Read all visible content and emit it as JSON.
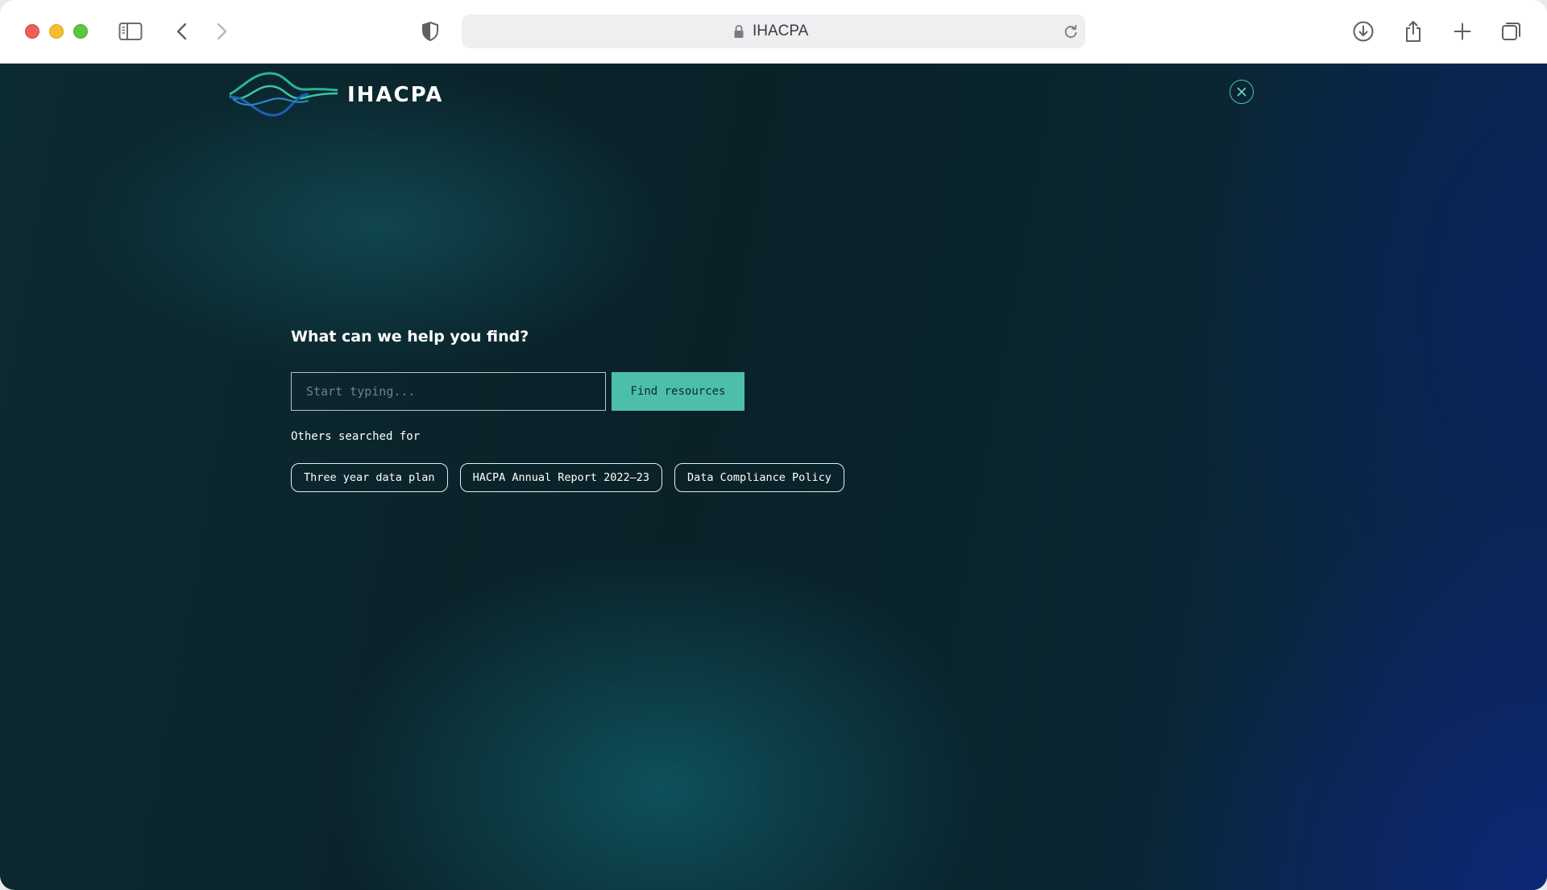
{
  "browser": {
    "url_text": "IHACPA",
    "icons": {
      "sidebar": "sidebar-icon",
      "back": "chevron-left-icon",
      "forward": "chevron-right-icon",
      "privacy": "shield-icon",
      "lock": "lock-icon",
      "reload": "reload-icon",
      "download": "download-icon",
      "share": "share-icon",
      "new_tab": "plus-icon",
      "tabs": "tabs-overview-icon"
    }
  },
  "page": {
    "logo_text": "IHACPA",
    "close_icon": "close-icon",
    "search": {
      "heading": "What can we help you find?",
      "placeholder": "Start typing...",
      "button_label": "Find resources"
    },
    "others_label": "Others searched for",
    "suggestions": [
      "Three year data plan",
      "HACPA Annual Report 2022–23",
      "Data Compliance Policy"
    ]
  },
  "colors": {
    "accent": "#4dbfa9",
    "background_dark": "#0a2128",
    "background_blue": "#0b2550"
  }
}
